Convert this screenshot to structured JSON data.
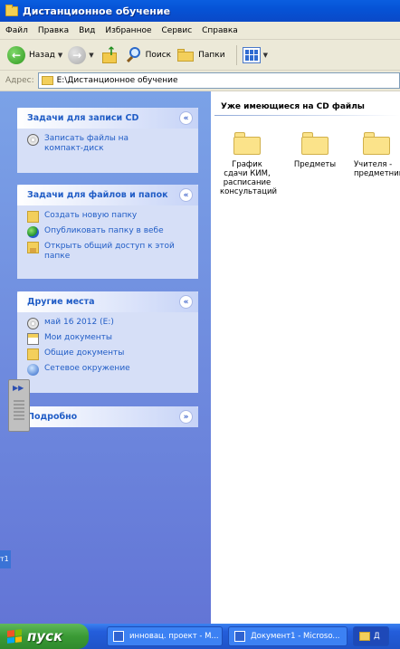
{
  "window": {
    "title": "Дистанционное обучение"
  },
  "menu": [
    "Файл",
    "Правка",
    "Вид",
    "Избранное",
    "Сервис",
    "Справка"
  ],
  "toolbar": {
    "back_label": "Назад",
    "search_label": "Поиск",
    "folders_label": "Папки"
  },
  "address": {
    "label": "Адрес:",
    "value": "E:\\Дистанционное обучение"
  },
  "tasks_cd": {
    "title": "Задачи для записи CD",
    "items": [
      "Записать файлы на компакт-диск"
    ]
  },
  "tasks_files": {
    "title": "Задачи для файлов и папок",
    "items": [
      "Создать новую папку",
      "Опубликовать папку в вебе",
      "Открыть общий доступ к этой папке"
    ]
  },
  "other_places": {
    "title": "Другие места",
    "items": [
      "май 16 2012 (E:)",
      "Мои документы",
      "Общие документы",
      "Сетевое окружение"
    ]
  },
  "details": {
    "title": "Подробно"
  },
  "content": {
    "group_title": "Уже имеющиеся на CD файлы",
    "files": [
      "График сдачи КИМ, расписание консультаций",
      "Предметы",
      "Учителя - предметник"
    ]
  },
  "leak_text": "т1",
  "taskbar": {
    "start_label": "пуск",
    "tasks": [
      "инновац. проект - M...",
      "Документ1 - Microso...",
      "Д"
    ]
  },
  "colors": {
    "title_blue": "#0a5ee0",
    "panel_blue": "#6d8fe0",
    "start_green": "#3a9a35"
  }
}
